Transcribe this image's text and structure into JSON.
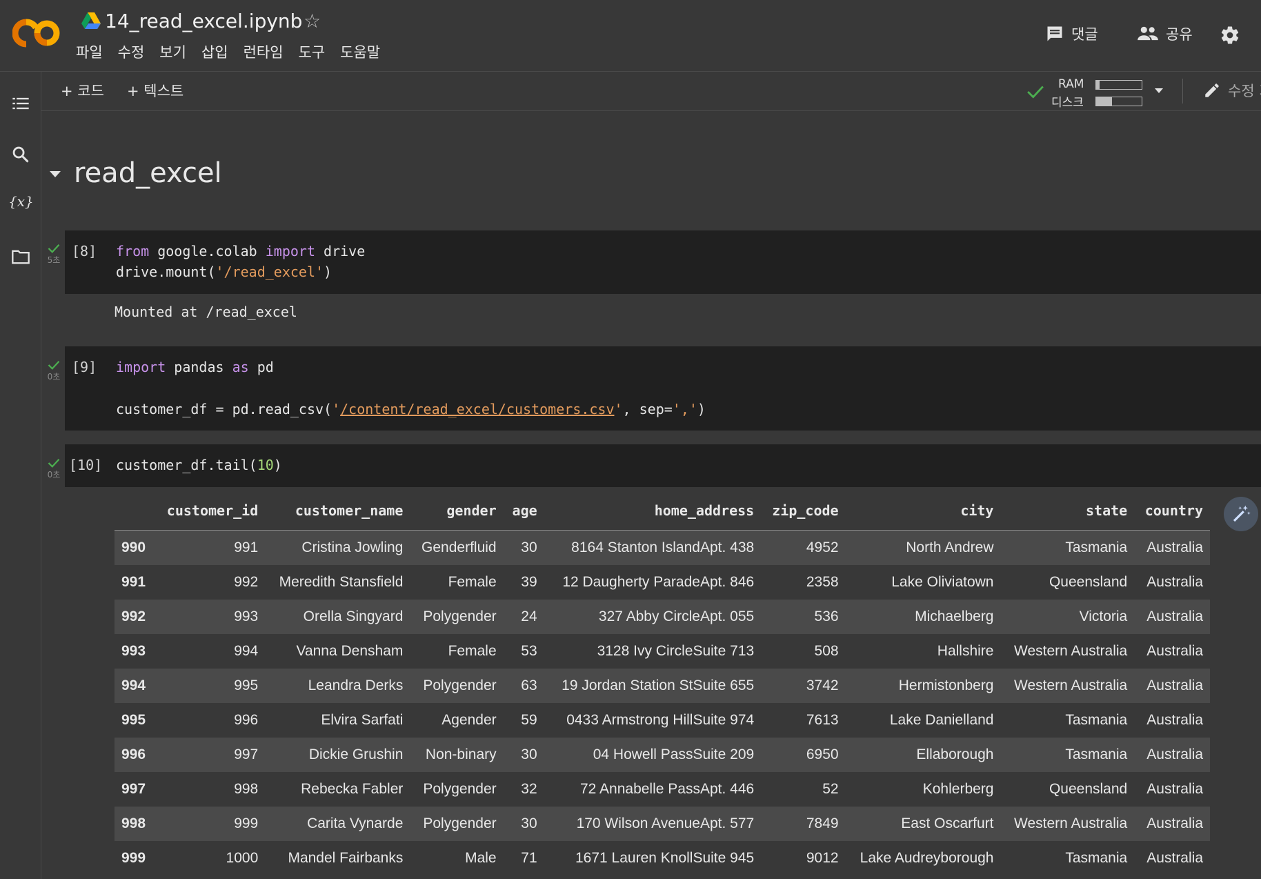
{
  "header": {
    "notebook_title": "14_read_excel.ipynb",
    "menu": [
      "파일",
      "수정",
      "보기",
      "삽입",
      "런타임",
      "도구",
      "도움말"
    ],
    "comment_label": "댓글",
    "share_label": "공유"
  },
  "toolbar": {
    "add_code_label": "+ 코드",
    "add_text_label": "+ 텍스트",
    "ram_label": "RAM",
    "disk_label": "디스크",
    "ram_usage_fraction": 0.08,
    "disk_usage_fraction": 0.35,
    "editable_label": "수정 가능"
  },
  "section": {
    "title": "read_excel"
  },
  "cells": [
    {
      "prompt": "[8]",
      "time": "5초",
      "code_line1_kw1": "from",
      "code_line1_mid": " google.colab ",
      "code_line1_kw2": "import",
      "code_line1_end": " drive",
      "code_line2_start": "drive.mount(",
      "code_line2_str": "'/read_excel'",
      "code_line2_end": ")",
      "output": "Mounted at /read_excel"
    },
    {
      "prompt": "[9]",
      "time": "0초",
      "code_line1_kw1": "import",
      "code_line1_mid": " pandas ",
      "code_line1_kw2": "as",
      "code_line1_end": " pd",
      "code_line2_start": "customer_df = pd.read_csv(",
      "code_line2_q1": "'",
      "code_line2_link": "/content/read_excel/customers.csv",
      "code_line2_q2": "'",
      "code_line2_mid": ", sep=",
      "code_line2_str": "','",
      "code_line2_end": ")"
    },
    {
      "prompt": "[10]",
      "time": "0초",
      "code_start": "customer_df.tail(",
      "code_num": "10",
      "code_end": ")"
    }
  ],
  "dataframe": {
    "columns": [
      "",
      "customer_id",
      "customer_name",
      "gender",
      "age",
      "home_address",
      "zip_code",
      "city",
      "state",
      "country"
    ],
    "rows": [
      [
        "990",
        "991",
        "Cristina Jowling",
        "Genderfluid",
        "30",
        "8164 Stanton IslandApt. 438",
        "4952",
        "North Andrew",
        "Tasmania",
        "Australia"
      ],
      [
        "991",
        "992",
        "Meredith Stansfield",
        "Female",
        "39",
        "12 Daugherty ParadeApt. 846",
        "2358",
        "Lake Oliviatown",
        "Queensland",
        "Australia"
      ],
      [
        "992",
        "993",
        "Orella Singyard",
        "Polygender",
        "24",
        "327 Abby CircleApt. 055",
        "536",
        "Michaelberg",
        "Victoria",
        "Australia"
      ],
      [
        "993",
        "994",
        "Vanna Densham",
        "Female",
        "53",
        "3128 Ivy CircleSuite 713",
        "508",
        "Hallshire",
        "Western Australia",
        "Australia"
      ],
      [
        "994",
        "995",
        "Leandra Derks",
        "Polygender",
        "63",
        "19 Jordan Station StSuite 655",
        "3742",
        "Hermistonberg",
        "Western Australia",
        "Australia"
      ],
      [
        "995",
        "996",
        "Elvira Sarfati",
        "Agender",
        "59",
        "0433 Armstrong HillSuite 974",
        "7613",
        "Lake Danielland",
        "Tasmania",
        "Australia"
      ],
      [
        "996",
        "997",
        "Dickie Grushin",
        "Non-binary",
        "30",
        "04 Howell PassSuite 209",
        "6950",
        "Ellaborough",
        "Tasmania",
        "Australia"
      ],
      [
        "997",
        "998",
        "Rebecka Fabler",
        "Polygender",
        "32",
        "72 Annabelle PassApt. 446",
        "52",
        "Kohlerberg",
        "Queensland",
        "Australia"
      ],
      [
        "998",
        "999",
        "Carita Vynarde",
        "Polygender",
        "30",
        "170 Wilson AvenueApt. 577",
        "7849",
        "East Oscarfurt",
        "Western Australia",
        "Australia"
      ],
      [
        "999",
        "1000",
        "Mandel Fairbanks",
        "Male",
        "71",
        "1671 Lauren KnollSuite 945",
        "9012",
        "Lake Audreyborough",
        "Tasmania",
        "Australia"
      ]
    ]
  },
  "icons": {
    "logo": "colab-logo",
    "drive": "google-drive-icon",
    "star": "star-icon",
    "comment": "comment-icon",
    "share": "people-icon",
    "settings": "gear-icon",
    "toc": "table-of-contents-icon",
    "search": "search-icon",
    "variables": "variables-icon",
    "files": "folder-icon",
    "editable": "pencil-icon",
    "magic": "magic-wand-icon"
  },
  "colors": {
    "background": "#383838",
    "code_cell": "#202020",
    "check": "#4caf50",
    "keyword": "#c792ea",
    "string": "#e39b5d",
    "number": "#a6d97a",
    "logo_orange": "#f9ab00",
    "logo_dark_orange": "#e37400"
  }
}
